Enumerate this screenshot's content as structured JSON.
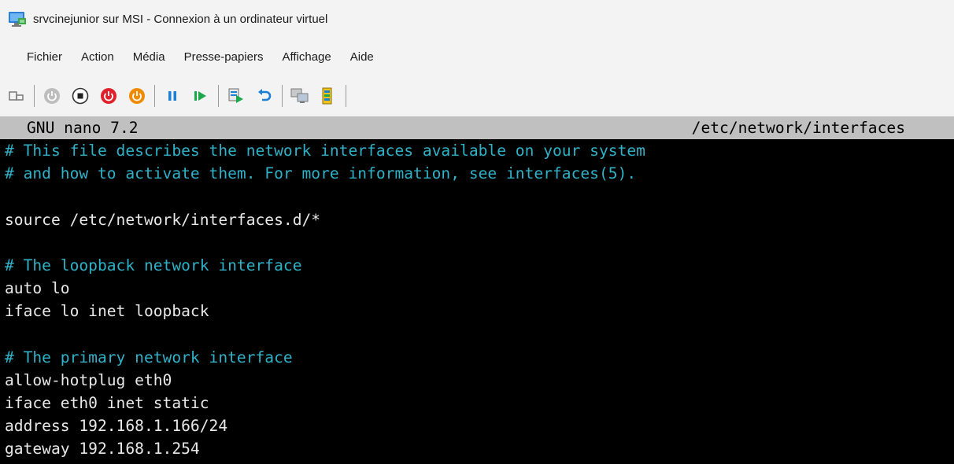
{
  "window": {
    "title": "srvcinejunior sur MSI - Connexion à un ordinateur virtuel",
    "icon": "virtual-machine-connection-icon"
  },
  "menu": {
    "items": [
      "Fichier",
      "Action",
      "Média",
      "Presse-papiers",
      "Affichage",
      "Aide"
    ]
  },
  "toolbar": {
    "buttons": [
      {
        "name": "ctrl-alt-del-button",
        "icon": "keyboard-icon"
      },
      {
        "name": "start-button",
        "icon": "power-gray-icon"
      },
      {
        "name": "turn-off-button",
        "icon": "stop-icon"
      },
      {
        "name": "shutdown-button",
        "icon": "power-red-icon"
      },
      {
        "name": "save-button",
        "icon": "power-orange-icon"
      },
      {
        "name": "pause-button",
        "icon": "pause-icon"
      },
      {
        "name": "resume-button",
        "icon": "play-icon"
      },
      {
        "name": "checkpoint-button",
        "icon": "checkpoint-icon"
      },
      {
        "name": "revert-button",
        "icon": "revert-icon"
      },
      {
        "name": "enhanced-session-button",
        "icon": "enhanced-session-icon"
      },
      {
        "name": "share-button",
        "icon": "share-icon"
      }
    ],
    "colors": {
      "blue": "#1c7fd6",
      "red": "#e0212b",
      "orange": "#f08a00",
      "green": "#1aa84a"
    }
  },
  "editor": {
    "version": "GNU nano 7.2",
    "filename": "/etc/network/interfaces",
    "lines": [
      {
        "text": "# This file describes the network interfaces available on your system",
        "kind": "comment"
      },
      {
        "text": "# and how to activate them. For more information, see interfaces(5).",
        "kind": "comment"
      },
      {
        "text": "",
        "kind": "code"
      },
      {
        "text": "source /etc/network/interfaces.d/*",
        "kind": "code"
      },
      {
        "text": "",
        "kind": "code"
      },
      {
        "text": "# The loopback network interface",
        "kind": "comment"
      },
      {
        "text": "auto lo",
        "kind": "code"
      },
      {
        "text": "iface lo inet loopback",
        "kind": "code"
      },
      {
        "text": "",
        "kind": "code"
      },
      {
        "text": "# The primary network interface",
        "kind": "comment"
      },
      {
        "text": "allow-hotplug eth0",
        "kind": "code"
      },
      {
        "text": "iface eth0 inet static",
        "kind": "code"
      },
      {
        "text": "address 192.168.1.166/24",
        "kind": "code"
      },
      {
        "text": "gateway 192.168.1.254",
        "kind": "code"
      }
    ],
    "colors": {
      "comment": "#2fb2c8",
      "code": "#e8e8e8",
      "header_bg": "#c0c0c0",
      "background": "#000000"
    }
  }
}
